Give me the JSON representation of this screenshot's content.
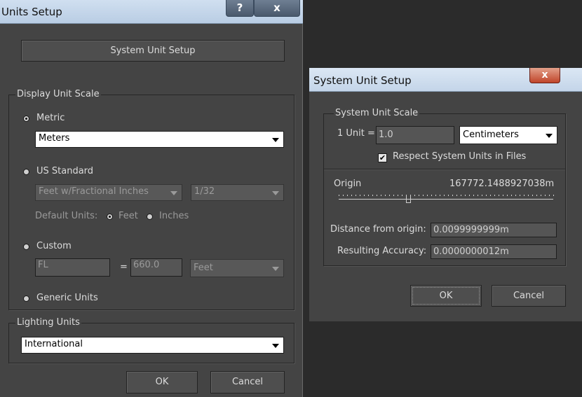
{
  "units_setup": {
    "title": "Units Setup",
    "help_label": "?",
    "close_label": "x",
    "system_unit_setup_button": "System Unit Setup",
    "display_unit_scale": {
      "legend": "Display Unit Scale",
      "metric_label": "Metric",
      "metric_selected": true,
      "metric_unit": "Meters",
      "us_standard_label": "US Standard",
      "us_unit": "Feet w/Fractional Inches",
      "us_fraction": "1/32",
      "default_units_label": "Default Units:",
      "feet_label": "Feet",
      "inches_label": "Inches",
      "custom_label": "Custom",
      "custom_name": "FL",
      "custom_equals": "=",
      "custom_value": "660.0",
      "custom_unit": "Feet",
      "generic_label": "Generic Units"
    },
    "lighting_units": {
      "legend": "Lighting Units",
      "value": "International"
    },
    "ok_label": "OK",
    "cancel_label": "Cancel"
  },
  "system_unit_setup": {
    "title": "System Unit Setup",
    "close_label": "x",
    "scale": {
      "legend": "System Unit Scale",
      "unit_label": "1 Unit =",
      "unit_value": "1.0",
      "unit_type": "Centimeters",
      "respect_label": "Respect System Units in Files",
      "respect_checked": true
    },
    "origin_label": "Origin",
    "origin_value": "167772.1488927038m",
    "distance_label": "Distance from origin:",
    "distance_value": "0.0099999999m",
    "accuracy_label": "Resulting Accuracy:",
    "accuracy_value": "0.0000000012m",
    "ok_label": "OK",
    "cancel_label": "Cancel"
  }
}
